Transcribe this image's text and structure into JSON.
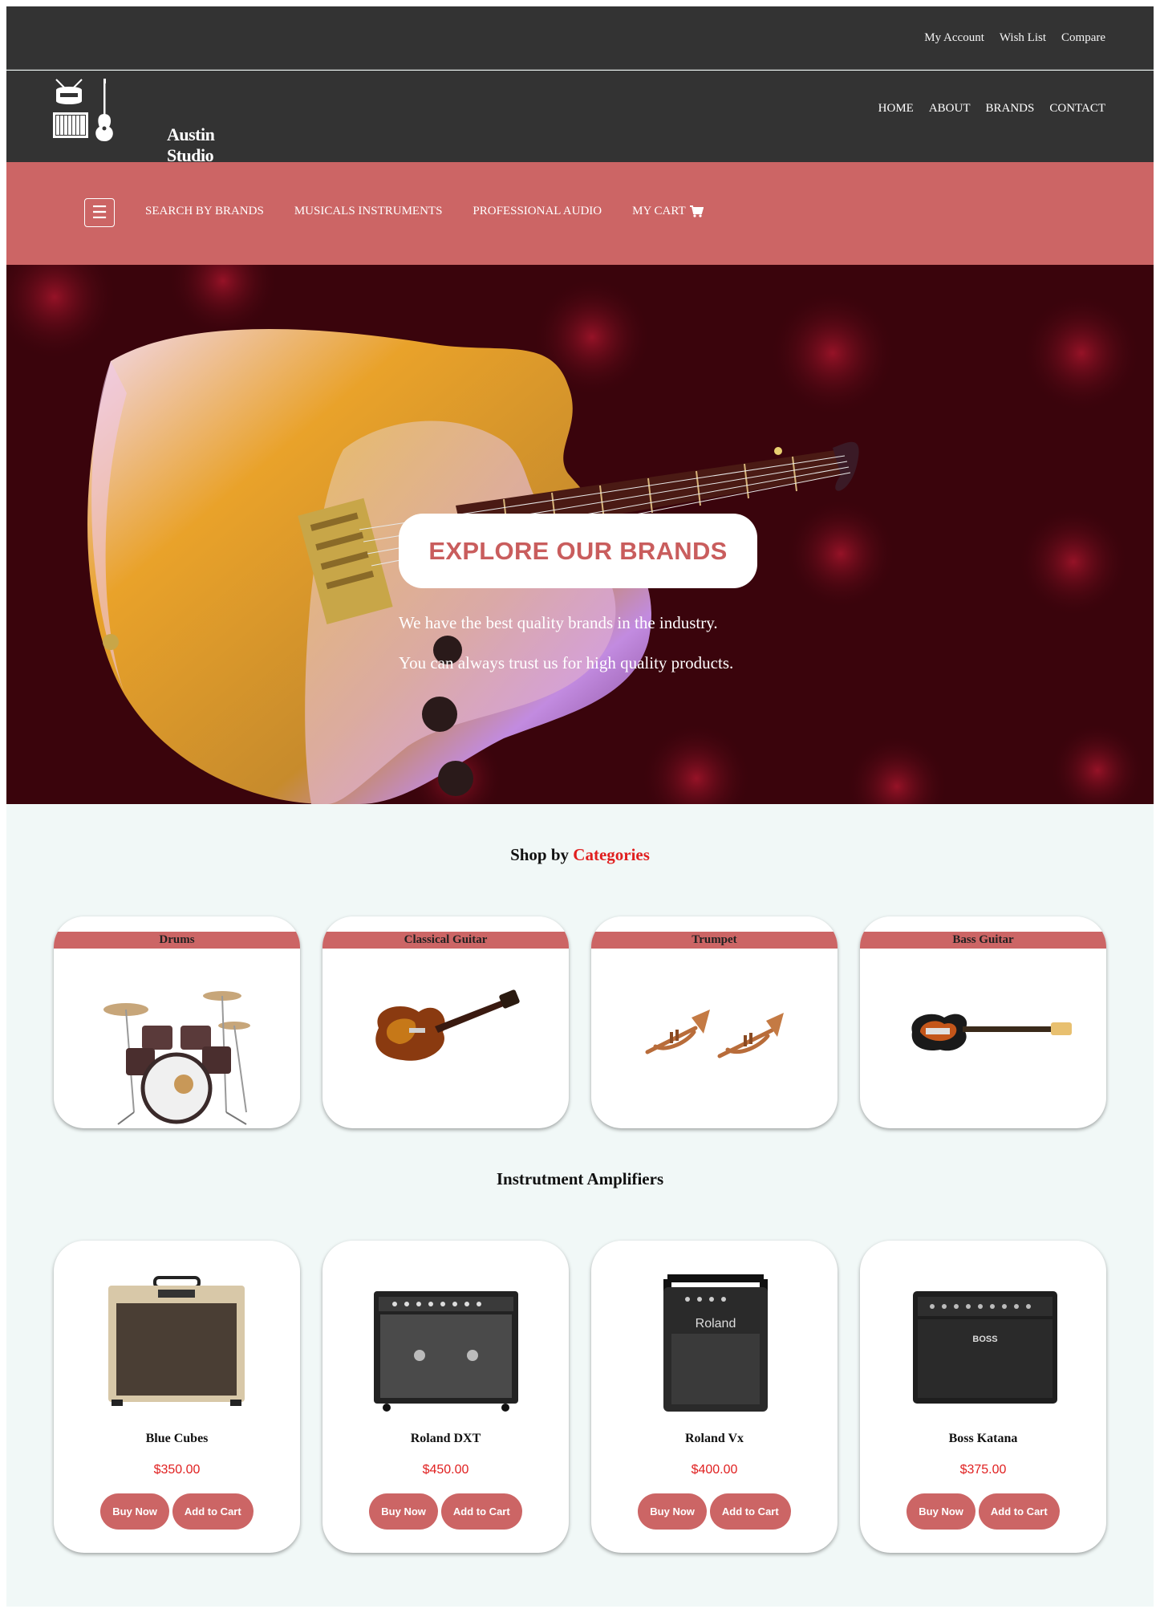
{
  "top_links": [
    "My Account",
    "Wish List",
    "Compare"
  ],
  "logo": {
    "text": "Austin Studio"
  },
  "main_nav": [
    "HOME",
    "ABOUT",
    "BRANDS",
    "CONTACT"
  ],
  "category_nav": {
    "menu_icon": "hamburger-icon",
    "items": [
      "SEARCH BY BRANDS",
      "MUSICALS INSTRUMENTS",
      "PROFESSIONAL AUDIO",
      "MY CART"
    ],
    "cart_icon": "cart-icon"
  },
  "hero": {
    "button": "EXPLORE OUR BRANDS",
    "line1": "We have the best quality brands in the industry.",
    "line2": "You can always trust us for high quality products."
  },
  "categories_section": {
    "title_prefix": "Shop by",
    "title_accent": "Categories",
    "items": [
      {
        "label": "Drums",
        "image": "drum-kit-image"
      },
      {
        "label": "Classical Guitar",
        "image": "electric-guitar-image"
      },
      {
        "label": "Trumpet",
        "image": "trumpets-image"
      },
      {
        "label": "Bass Guitar",
        "image": "bass-guitar-image"
      }
    ]
  },
  "amplifiers_section": {
    "title": "Instrutment Amplifiers",
    "items": [
      {
        "name": "Blue Cubes",
        "price": "$350.00",
        "buy": "Buy Now",
        "cart": "Add to Cart",
        "brand_plate": ""
      },
      {
        "name": "Roland DXT",
        "price": "$450.00",
        "buy": "Buy Now",
        "cart": "Add to Cart",
        "brand_plate": ""
      },
      {
        "name": "Roland Vx",
        "price": "$400.00",
        "buy": "Buy Now",
        "cart": "Add to Cart",
        "brand_plate": "Roland"
      },
      {
        "name": "Boss Katana",
        "price": "$375.00",
        "buy": "Buy Now",
        "cart": "Add to Cart",
        "brand_plate": "BOSS"
      }
    ]
  },
  "colors": {
    "dark": "#333333",
    "accent": "#cc6565",
    "price": "#e01f1f",
    "page_bg": "#f1f8f7"
  }
}
